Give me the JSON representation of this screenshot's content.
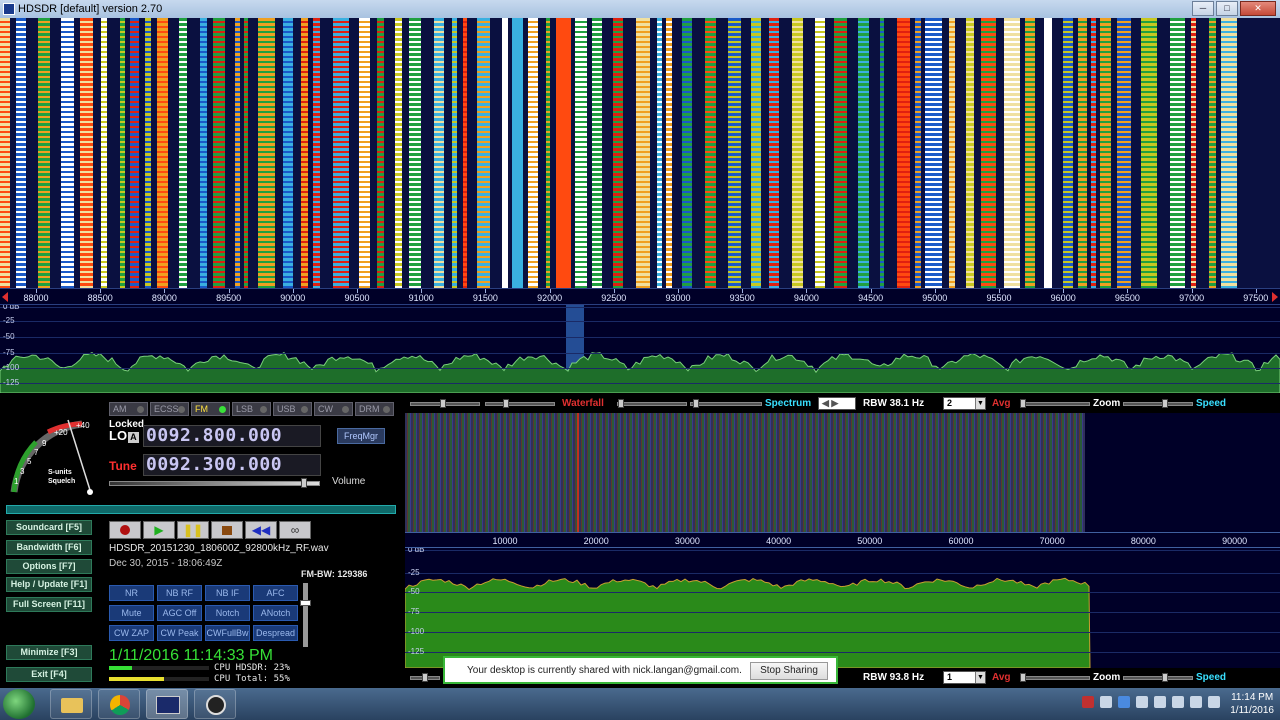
{
  "window": {
    "title": "HDSDR [default]  version 2.70"
  },
  "top_axis": {
    "labels": [
      "88000",
      "88500",
      "89000",
      "89500",
      "90000",
      "90500",
      "91000",
      "91500",
      "92000",
      "92500",
      "93000",
      "93500",
      "94000",
      "94500",
      "95000",
      "95500",
      "96000",
      "96500",
      "97000",
      "97500"
    ]
  },
  "top_spectrum": {
    "db_labels": [
      "0 dB",
      "-25",
      "-50",
      "-75",
      "-100",
      "-125"
    ]
  },
  "controls_bar_1": {
    "waterfall_label": "Waterfall",
    "spectrum_label": "Spectrum",
    "rbw": "RBW 38.1 Hz",
    "avg_value": "2",
    "avg_label": "Avg",
    "zoom_label": "Zoom",
    "speed_label": "Speed"
  },
  "controls_bar_2": {
    "rbw": "RBW 93.8 Hz",
    "avg_value": "1",
    "avg_label": "Avg",
    "zoom_label": "Zoom",
    "speed_label": "Speed"
  },
  "smeter": {
    "labels": [
      "+40",
      "+20",
      "9",
      "7",
      "5",
      "3",
      "1"
    ],
    "caption1": "S-units",
    "caption2": "Squelch"
  },
  "modes": [
    {
      "label": "AM",
      "active": false
    },
    {
      "label": "ECSS",
      "active": false
    },
    {
      "label": "FM",
      "active": true
    },
    {
      "label": "LSB",
      "active": false
    },
    {
      "label": "USB",
      "active": false
    },
    {
      "label": "CW",
      "active": false
    },
    {
      "label": "DRM",
      "active": false
    }
  ],
  "lo": {
    "locked": "Locked",
    "label": "LO",
    "badge": "A",
    "freq": "0092.800.000"
  },
  "tune": {
    "label": "Tune",
    "freq": "0092.300.000"
  },
  "freqmgr": "FreqMgr",
  "volume_label": "Volume",
  "left_buttons": [
    "Soundcard  [F5]",
    "Bandwidth  [F6]",
    "Options  [F7]",
    "Help / Update  [F1]",
    "Full Screen  [F11]",
    "Minimize  [F3]",
    "Exit  [F4]"
  ],
  "file": {
    "name": "HDSDR_20151230_180600Z_92800kHz_RF.wav",
    "date": "Dec 30, 2015 - 18:06:49Z"
  },
  "fm_bw": "FM-BW: 129386",
  "dsp_buttons": [
    "NR",
    "NB RF",
    "NB IF",
    "AFC",
    "Mute",
    "AGC Off",
    "Notch",
    "ANotch",
    "CW ZAP",
    "CW Peak",
    "CWFullBw",
    "Despread"
  ],
  "clock": "1/11/2016 11:14:33 PM",
  "cpu": {
    "hdsdr": "CPU HDSDR: 23%",
    "total": "CPU Total: 55%",
    "hdsdr_level": 0.23,
    "total_level": 0.55
  },
  "bottom_axis": {
    "labels": [
      "10000",
      "20000",
      "30000",
      "40000",
      "50000",
      "60000",
      "70000",
      "80000",
      "90000"
    ]
  },
  "bottom_spectrum": {
    "db_labels": [
      "0 dB",
      "-25",
      "-50",
      "-75",
      "-100",
      "-125"
    ]
  },
  "share": {
    "message": "Your desktop is currently shared with nick.langan@gmail.com.",
    "button": "Stop Sharing"
  },
  "taskbar": {
    "time": "11:14 PM",
    "date": "1/11/2016",
    "apps": [
      "windows-explorer",
      "chrome",
      "hdsdr",
      "obs"
    ]
  },
  "colors": {
    "accent_green": "#36e036",
    "tune_red": "#ff3030",
    "freq_text": "#c9c6f2",
    "spectrum_bg": "#000028"
  }
}
